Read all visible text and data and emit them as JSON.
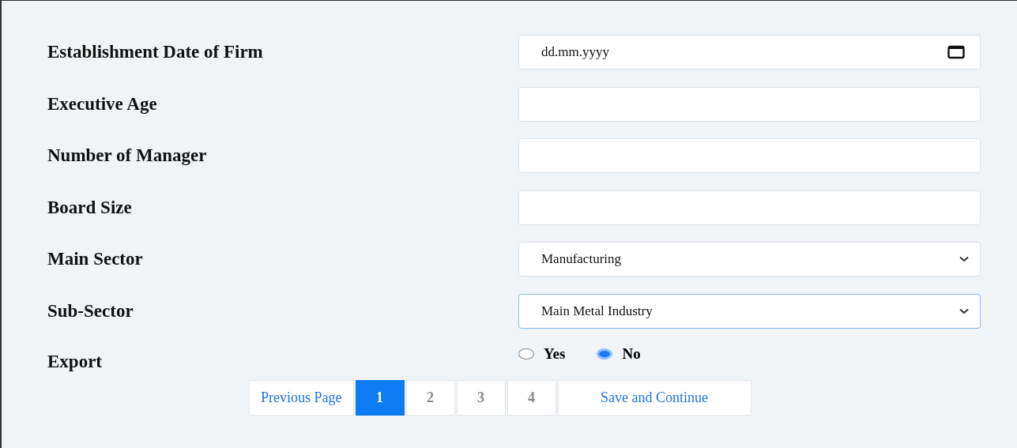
{
  "fields": [
    {
      "label": "Establishment Date of Firm",
      "kind": "date",
      "placeholder": "dd.mm.yyyy",
      "focused": false
    },
    {
      "label": "Executive Age",
      "kind": "text",
      "focused": false
    },
    {
      "label": "Number of Manager",
      "kind": "text",
      "focused": false
    },
    {
      "label": "Board Size",
      "kind": "text",
      "focused": false
    },
    {
      "label": "Main Sector",
      "kind": "select",
      "value": "Manufacturing",
      "focused": false
    },
    {
      "label": "Sub-Sector",
      "kind": "select",
      "value": "Main Metal Industry",
      "focused": true
    },
    {
      "label": "Export",
      "kind": "radio",
      "options": [
        {
          "label": "Yes",
          "selected": false
        },
        {
          "label": "No",
          "selected": true
        }
      ]
    }
  ],
  "pagination": {
    "previous": "Previous Page",
    "pages": [
      {
        "label": "1",
        "selected": true
      },
      {
        "label": "2",
        "selected": false
      },
      {
        "label": "3",
        "selected": false
      },
      {
        "label": "4",
        "selected": false
      }
    ],
    "next": "Save and Continue"
  }
}
